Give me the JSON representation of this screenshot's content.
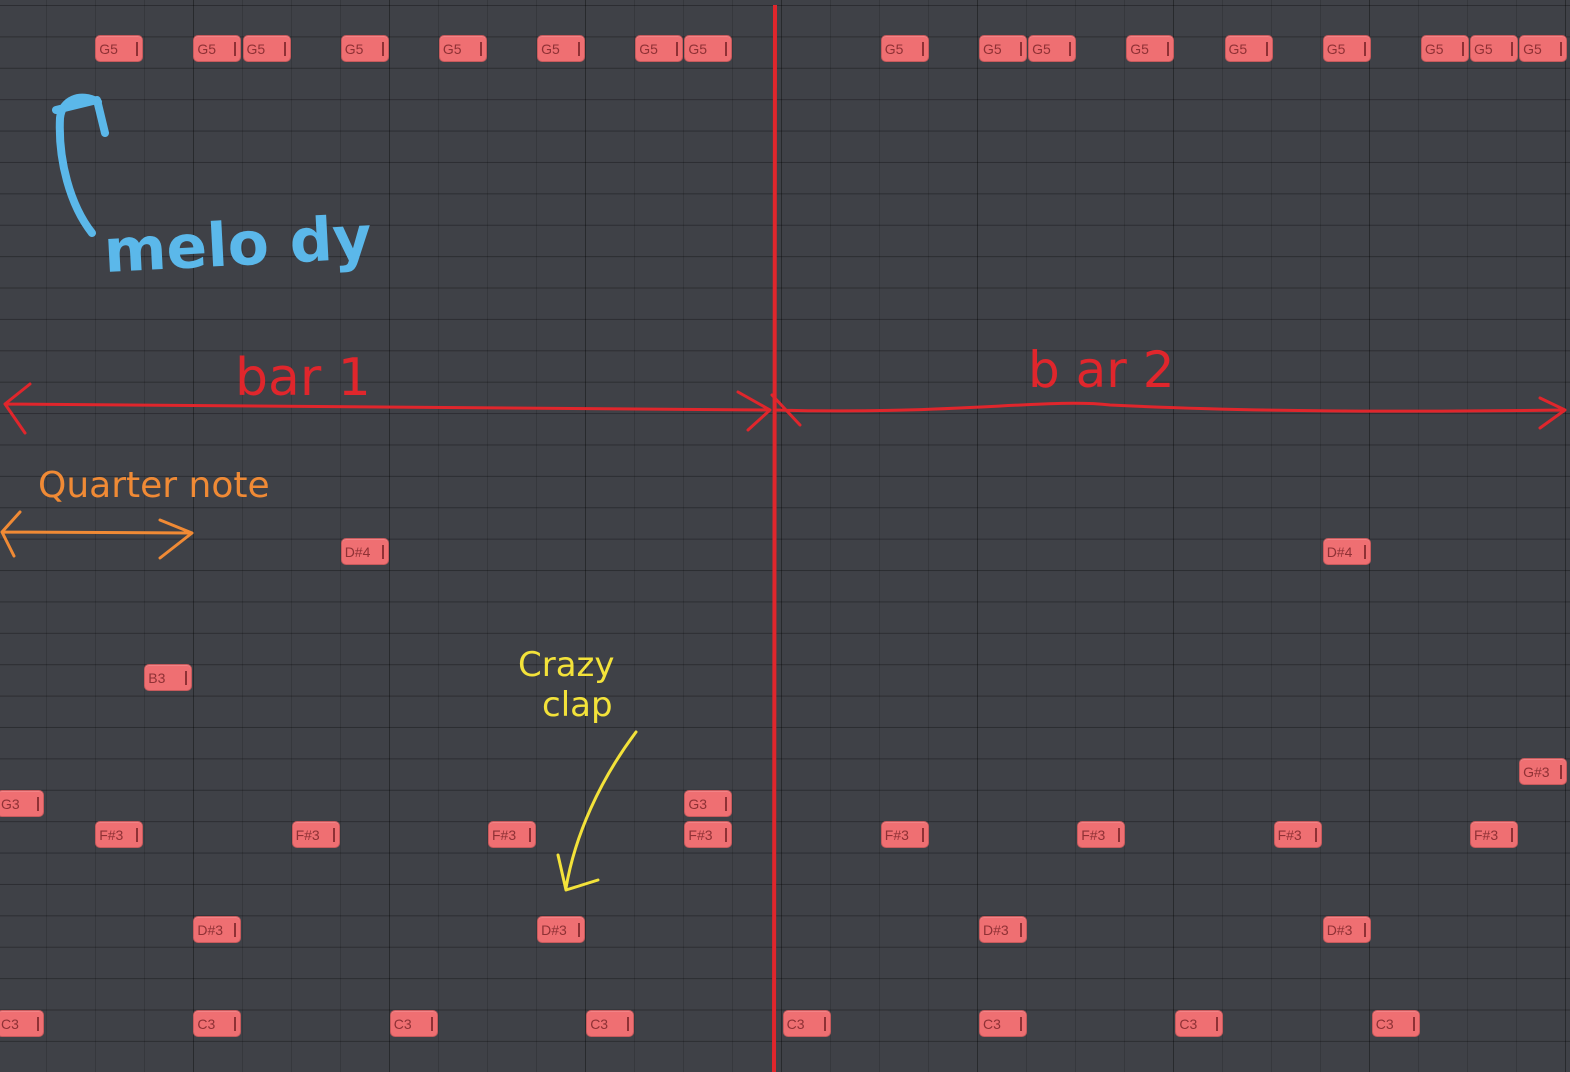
{
  "piano_roll": {
    "notes": [
      {
        "label": "G5",
        "row": 0,
        "step": 2
      },
      {
        "label": "G5",
        "row": 0,
        "step": 4
      },
      {
        "label": "G5",
        "row": 0,
        "step": 5
      },
      {
        "label": "G5",
        "row": 0,
        "step": 7
      },
      {
        "label": "G5",
        "row": 0,
        "step": 9
      },
      {
        "label": "G5",
        "row": 0,
        "step": 11
      },
      {
        "label": "G5",
        "row": 0,
        "step": 13
      },
      {
        "label": "G5",
        "row": 0,
        "step": 14
      },
      {
        "label": "G5",
        "row": 0,
        "step": 18
      },
      {
        "label": "G5",
        "row": 0,
        "step": 20
      },
      {
        "label": "G5",
        "row": 0,
        "step": 21
      },
      {
        "label": "G5",
        "row": 0,
        "step": 23
      },
      {
        "label": "G5",
        "row": 0,
        "step": 25
      },
      {
        "label": "G5",
        "row": 0,
        "step": 27
      },
      {
        "label": "G5",
        "row": 0,
        "step": 29
      },
      {
        "label": "G5",
        "row": 0,
        "step": 30
      },
      {
        "label": "G5",
        "row": 0,
        "step": 31
      },
      {
        "label": "D#4",
        "row": 16,
        "step": 7
      },
      {
        "label": "D#4",
        "row": 16,
        "step": 27
      },
      {
        "label": "B3",
        "row": 20,
        "step": 3
      },
      {
        "label": "G#3",
        "row": 23,
        "step": 31
      },
      {
        "label": "G3",
        "row": 24,
        "step": 0
      },
      {
        "label": "G3",
        "row": 24,
        "step": 14
      },
      {
        "label": "F#3",
        "row": 25,
        "step": 2
      },
      {
        "label": "F#3",
        "row": 25,
        "step": 6
      },
      {
        "label": "F#3",
        "row": 25,
        "step": 10
      },
      {
        "label": "F#3",
        "row": 25,
        "step": 14
      },
      {
        "label": "F#3",
        "row": 25,
        "step": 18
      },
      {
        "label": "F#3",
        "row": 25,
        "step": 22
      },
      {
        "label": "F#3",
        "row": 25,
        "step": 26
      },
      {
        "label": "F#3",
        "row": 25,
        "step": 30
      },
      {
        "label": "D#3",
        "row": 28,
        "step": 4
      },
      {
        "label": "D#3",
        "row": 28,
        "step": 11
      },
      {
        "label": "D#3",
        "row": 28,
        "step": 20
      },
      {
        "label": "D#3",
        "row": 28,
        "step": 27
      },
      {
        "label": "C3",
        "row": 31,
        "step": 0
      },
      {
        "label": "C3",
        "row": 31,
        "step": 4
      },
      {
        "label": "C3",
        "row": 31,
        "step": 8
      },
      {
        "label": "C3",
        "row": 31,
        "step": 12
      },
      {
        "label": "C3",
        "row": 31,
        "step": 16
      },
      {
        "label": "C3",
        "row": 31,
        "step": 20
      },
      {
        "label": "C3",
        "row": 31,
        "step": 24
      },
      {
        "label": "C3",
        "row": 31,
        "step": 28
      }
    ]
  },
  "annotations": {
    "melody": "melo dy",
    "bar1": "bar 1",
    "bar2": "b ar 2",
    "quarter_note": "Quarter note",
    "crazy_clap_line1": "Crazy",
    "crazy_clap_line2": "clap",
    "colors": {
      "melody": "#5bb8ea",
      "bar": "#e0262c",
      "quarter": "#f08a35",
      "clap": "#f3e23a",
      "note_fill": "#ef6f72"
    }
  }
}
